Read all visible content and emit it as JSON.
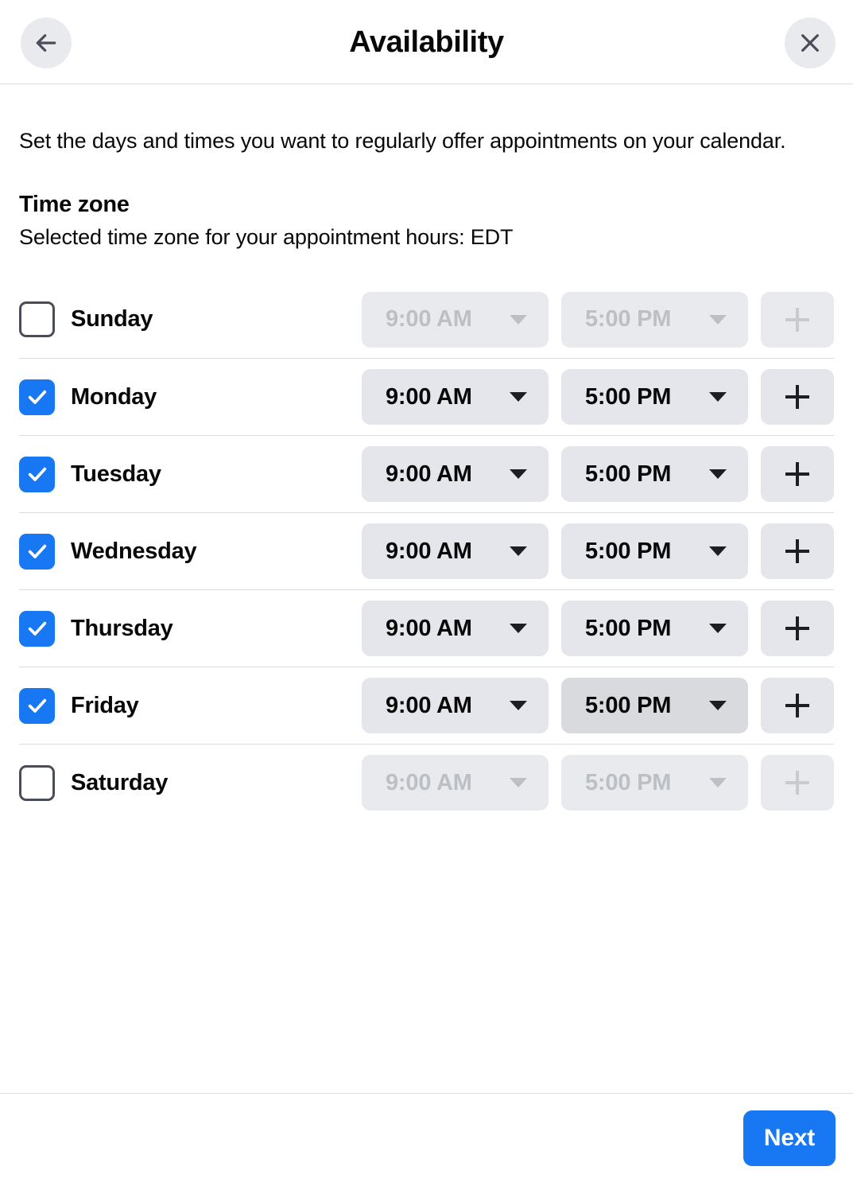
{
  "header": {
    "title": "Availability",
    "back_icon": "arrow-left-icon",
    "close_icon": "close-icon"
  },
  "intro": {
    "description": "Set the days and times you want to regularly offer appointments on your calendar."
  },
  "time_zone": {
    "heading": "Time zone",
    "subtext": "Selected time zone for your appointment hours: EDT",
    "value": "EDT"
  },
  "schedule": {
    "add_label": "+",
    "days": [
      {
        "name": "Sunday",
        "enabled": false,
        "start": "9:00 AM",
        "end": "5:00 PM",
        "end_hovered": false
      },
      {
        "name": "Monday",
        "enabled": true,
        "start": "9:00 AM",
        "end": "5:00 PM",
        "end_hovered": false
      },
      {
        "name": "Tuesday",
        "enabled": true,
        "start": "9:00 AM",
        "end": "5:00 PM",
        "end_hovered": false
      },
      {
        "name": "Wednesday",
        "enabled": true,
        "start": "9:00 AM",
        "end": "5:00 PM",
        "end_hovered": false
      },
      {
        "name": "Thursday",
        "enabled": true,
        "start": "9:00 AM",
        "end": "5:00 PM",
        "end_hovered": false
      },
      {
        "name": "Friday",
        "enabled": true,
        "start": "9:00 AM",
        "end": "5:00 PM",
        "end_hovered": true
      },
      {
        "name": "Saturday",
        "enabled": false,
        "start": "9:00 AM",
        "end": "5:00 PM",
        "end_hovered": false
      }
    ]
  },
  "footer": {
    "next_label": "Next"
  },
  "colors": {
    "accent": "#1877f2",
    "control_bg": "#e4e6eb",
    "control_bg_hover": "#d8dade",
    "text": "#080809",
    "disabled_text": "#bcc0c4",
    "divider": "#d9dbdf"
  }
}
